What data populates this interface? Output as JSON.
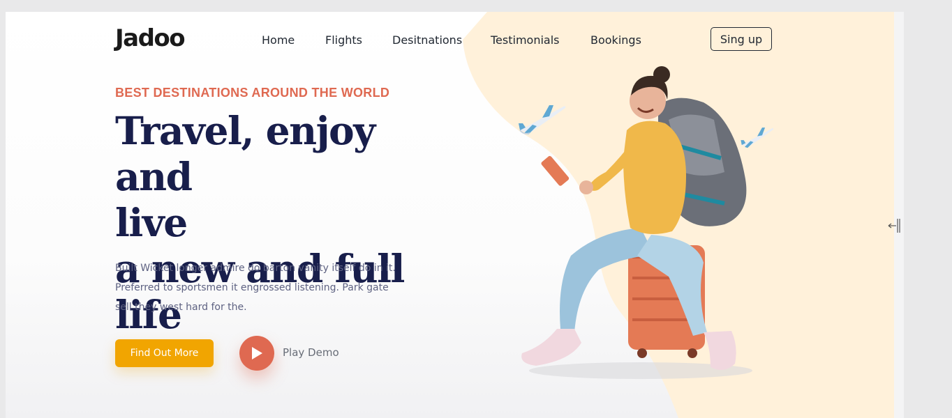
{
  "brand": {
    "logo": "Jadoo"
  },
  "nav": {
    "links": [
      "Home",
      "Flights",
      "Desitnations",
      "Testimonials",
      "Bookings"
    ],
    "signup_label": "Sing up"
  },
  "hero": {
    "eyebrow": "BEST DESTINATIONS AROUND THE WORLD",
    "headline_lines": [
      "Travel, enjoy and",
      "live",
      "a new and full life"
    ],
    "description_lines": [
      "Built Wicket longer admire do barton vanity itself do in it.",
      "Preferred to sportsmen it engrossed listening. Park gate",
      "sell they west hard for the."
    ],
    "cta_label": "Find Out More",
    "play_label": "Play Demo"
  },
  "colors": {
    "accent_orange": "#df6951",
    "cta_yellow": "#f1a501",
    "navy": "#181e4b",
    "blob": "#fff1da"
  },
  "icons": {
    "play": "play-icon",
    "plane": "airplane-icon",
    "resize": "resize-handle-icon"
  }
}
